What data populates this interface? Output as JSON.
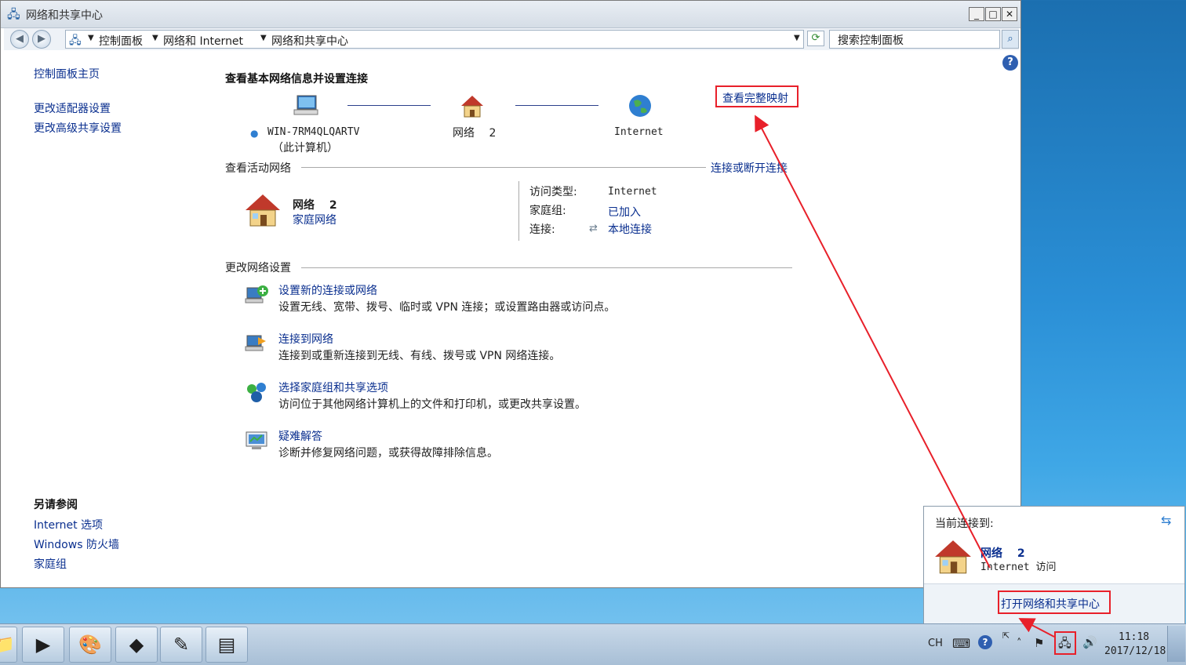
{
  "window": {
    "title": "网络和共享中心",
    "buttons": {
      "minimize": "_",
      "maximize": "□",
      "close": "✕"
    }
  },
  "address": {
    "back": "◀",
    "forward": "▶",
    "crumbs": [
      "控制面板",
      "网络和 Internet",
      "网络和共享中心"
    ],
    "search_placeholder": "搜索控制面板"
  },
  "sidebar": {
    "home": "控制面板主页",
    "items": [
      "更改适配器设置",
      "更改高级共享设置"
    ],
    "see_also_title": "另请参阅",
    "see_also": [
      "Internet 选项",
      "Windows 防火墙",
      "家庭组"
    ]
  },
  "main": {
    "heading": "查看基本网络信息并设置连接",
    "full_map": "查看完整映射",
    "map": {
      "computer_name": "WIN-7RM4QLQARTV",
      "computer_sub": "（此计算机）",
      "network": "网络　 2",
      "internet": "Internet"
    },
    "active_section": "查看活动网络",
    "connect_disconnect": "连接或断开连接",
    "active": {
      "name": "网络　 2",
      "type": "家庭网络",
      "access_label": "访问类型:",
      "access_value": "Internet",
      "homegroup_label": "家庭组:",
      "homegroup_value": "已加入",
      "connection_label": "连接:",
      "connection_value": "本地连接"
    },
    "change_section": "更改网络设置",
    "tasks": [
      {
        "title": "设置新的连接或网络",
        "desc": "设置无线、宽带、拨号、临时或 VPN 连接；或设置路由器或访问点。"
      },
      {
        "title": "连接到网络",
        "desc": "连接到或重新连接到无线、有线、拨号或 VPN 网络连接。"
      },
      {
        "title": "选择家庭组和共享选项",
        "desc": "访问位于其他网络计算机上的文件和打印机，或更改共享设置。"
      },
      {
        "title": "疑难解答",
        "desc": "诊断并修复网络问题，或获得故障排除信息。"
      }
    ]
  },
  "popup": {
    "header": "当前连接到:",
    "network": "网络　 2",
    "access": "Internet 访问",
    "open_center": "打开网络和共享中心"
  },
  "taskbar": {
    "lang": "CH",
    "time": "11:18",
    "date": "2017/12/18"
  },
  "icons": [
    "computer-icon",
    "house-icon",
    "globe-icon",
    "network-setup-icon",
    "connect-icon",
    "homegroup-icon",
    "troubleshoot-icon"
  ]
}
